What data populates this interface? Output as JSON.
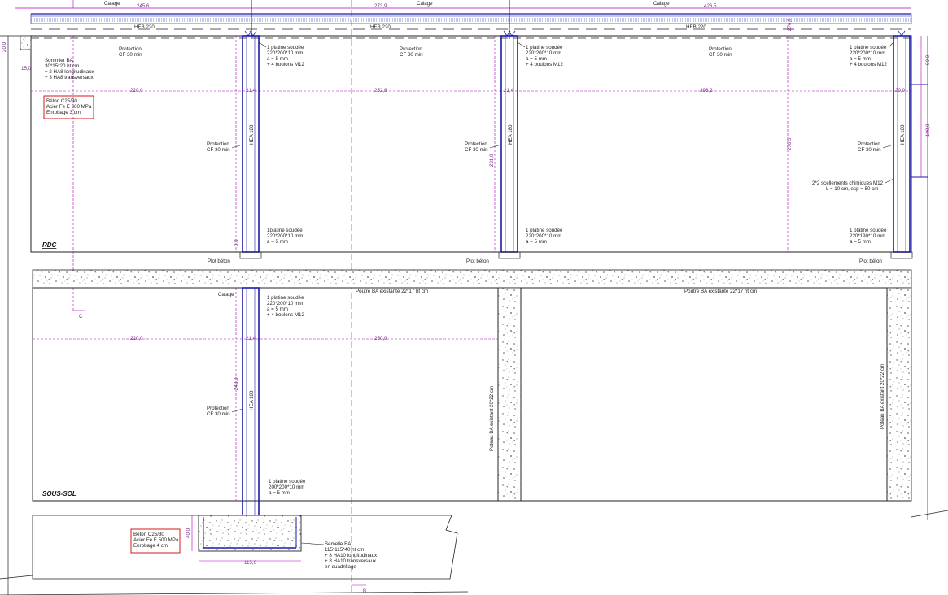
{
  "levels": {
    "rdc": "RDC",
    "sous_sol": "SOUS-SOL"
  },
  "top_dims": {
    "d1": "245,6",
    "d2": "273,9",
    "d3": "426,5",
    "calage": "Calage"
  },
  "beam_labels": {
    "heb_left": "HEB 220",
    "heb_mid": "HEB 220",
    "heb_right": "HEB 220"
  },
  "rdc_dims": {
    "d1": "220,0",
    "d2": "21,4",
    "d3": "252,8",
    "d4": "21,4",
    "d5": "396,2",
    "d6": "20,0",
    "h_left": "20,0",
    "w_left": "15,0",
    "h1": "276,5",
    "h2": "276,5",
    "h3": "231,0",
    "v1": "90,0",
    "v2": "100,0",
    "s1": "3,0"
  },
  "sousol_dims": {
    "d1": "220,0",
    "d2": "21,4",
    "d3": "250,9",
    "h1": "240,0",
    "f_h": "40,0",
    "f_w": "115,0"
  },
  "sommier": {
    "l1": "Sommier BA",
    "l2": "30*15*20 ht cm",
    "l3": "+ 2 HA8 longitudinaux",
    "l4": "+ 3 HA8 transversaux"
  },
  "spec_box_top": {
    "l1": "Béton C25/30",
    "l2": "Acier Fe E 500 MPa",
    "l3": "Enrobage 3 cm"
  },
  "spec_box_bottom": {
    "l1": "Béton C25/30",
    "l2": "Acier Fe E 500 MPa",
    "l3": "Enrobage 4 cm"
  },
  "protection": {
    "l1": "Protection",
    "l2": "CF 30 min"
  },
  "platine_top": {
    "l1": "1 platine soudée",
    "l2": "220*200*10 mm",
    "l3": "a = 5 mm",
    "l4": "+ 4 boulons M12"
  },
  "platine_bottom": {
    "l1": "1platine soudée",
    "l2": "220*200*10 mm",
    "l3": "a = 5 mm"
  },
  "platine_bottom_mid": {
    "l1": "1 platine soudée",
    "l2": "220*200*10 mm",
    "l3": "a = 5 mm"
  },
  "platine_bottom_right": {
    "l1": "1 platine soudée",
    "l2": "220*190*10 mm",
    "l3": "a = 5 mm"
  },
  "scellement": {
    "l1": "2*2 scellements chimiques M12",
    "l2": "L = 10 cm, esp = 50 cm"
  },
  "plot": "Plot béton",
  "column_tag": "HEA 180",
  "poutre_existante": "Poutre BA existante 22*17 ht cm",
  "poteau_existant": "Poteau BA existant 20*22 cm",
  "calage_ss": "Calage",
  "platine_ss_top": {
    "l1": "1 platine soudée",
    "l2": "220*200*10 mm",
    "l3": "a = 5 mm",
    "l4": "+ 4 boulons M12"
  },
  "platine_ss_bottom": {
    "l1": "1 platine soudée",
    "l2": "200*200*10 mm",
    "l3": "a = 5 mm"
  },
  "semelle": {
    "l1": "Semelle BA",
    "l2": "115*115*40 ht cm",
    "l3": "+ 8 HA10 longitudinaux",
    "l4": "+ 8 HA10 transversaux",
    "l5": "en quadrillage"
  },
  "section_marks": {
    "c": "C",
    "b": "B"
  },
  "colors": {
    "steel": "#1a1aa8",
    "dim": "#b000c0",
    "line": "#222222",
    "box": "#cc0000",
    "concrete": "#444444"
  }
}
